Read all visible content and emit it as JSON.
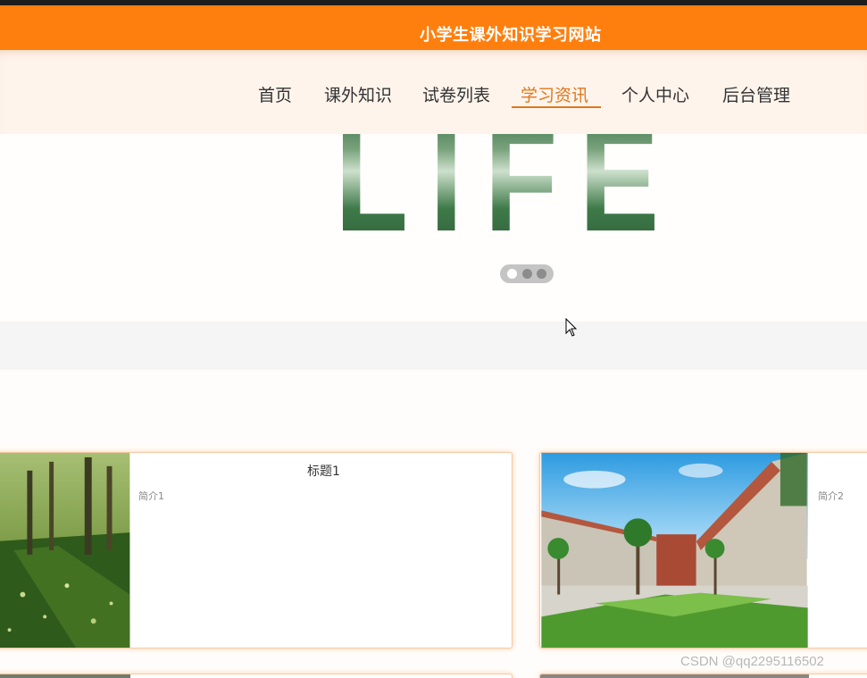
{
  "site": {
    "title": "小学生课外知识学习网站"
  },
  "nav": {
    "items": [
      {
        "label": "首页"
      },
      {
        "label": "课外知识"
      },
      {
        "label": "试卷列表"
      },
      {
        "label": "学习资讯",
        "active": true
      },
      {
        "label": "个人中心"
      },
      {
        "label": "后台管理"
      }
    ]
  },
  "banner": {
    "text": "LIFE",
    "active_slide": 1,
    "slide_count": 3
  },
  "cards": [
    {
      "title": "标题1",
      "desc": "简介1",
      "image": "forest-path-photo"
    },
    {
      "title": "",
      "desc": "简介2",
      "image": "campus-courtyard-photo"
    }
  ],
  "watermark": "CSDN @qq2295116502",
  "colors": {
    "accent": "#ff7f0e",
    "active_nav": "#e0781d",
    "nav_bg": "#fef4ec"
  }
}
